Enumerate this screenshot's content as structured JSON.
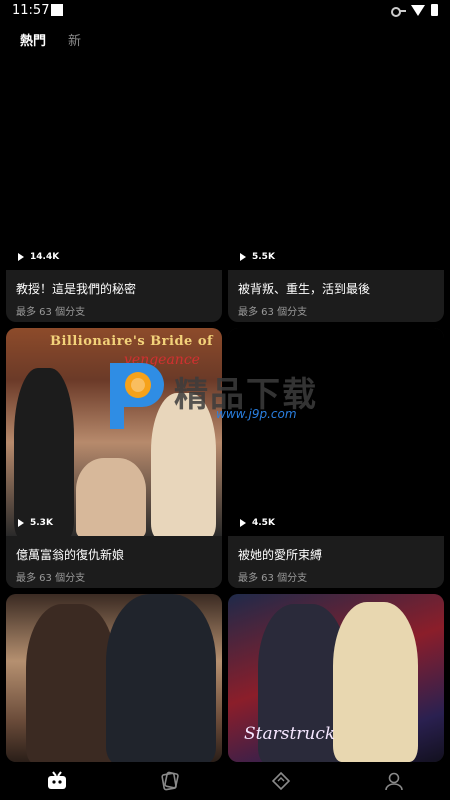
{
  "status_bar": {
    "time": "11:57"
  },
  "tabs": [
    {
      "label": "熱門"
    },
    {
      "label": "新"
    }
  ],
  "cards": [
    {
      "views": "14.4K",
      "title": "教授！這是我們的秘密",
      "subtitle": "最多 63 個分支"
    },
    {
      "views": "5.5K",
      "title": "被背叛、重生，活到最後",
      "subtitle": "最多 63 個分支"
    },
    {
      "views": "5.3K",
      "title": "億萬富翁的復仇新娘",
      "subtitle": "最多 63 個分支",
      "poster_text": "Billionaire's Bride of",
      "poster_text_red": "vengeance"
    },
    {
      "views": "4.5K",
      "title": "被她的愛所束縛",
      "subtitle": "最多 63 個分支"
    },
    {
      "poster_text": ""
    },
    {
      "poster_text": "Starstruck"
    }
  ],
  "watermark": {
    "text": "精品下载",
    "url": "www.j9p.com"
  },
  "bottom_nav": [
    {
      "icon": "home-tv-icon"
    },
    {
      "icon": "cards-icon"
    },
    {
      "icon": "diamond-icon"
    },
    {
      "icon": "profile-icon"
    }
  ]
}
